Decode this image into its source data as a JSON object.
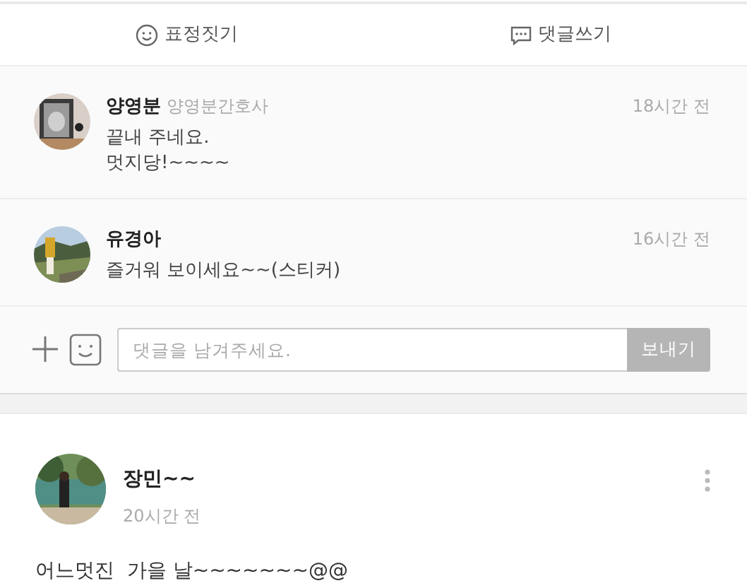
{
  "actions": [
    {
      "kind": "emoji",
      "label": "표정짓기"
    },
    {
      "kind": "comment",
      "label": "댓글쓰기"
    }
  ],
  "comments": [
    {
      "author": "양영분",
      "subtitle": "양영분간호사",
      "time": "18시간 전",
      "text": "끝내 주네요.\n멋지당!~~~~"
    },
    {
      "author": "유경아",
      "time": "16시간 전",
      "text": "즐거워 보이세요~~(스티커)"
    }
  ],
  "composer": {
    "placeholder": "댓글을 남겨주세요.",
    "send": "보내기"
  },
  "post": {
    "author": "장민~~",
    "time": "20시간 전",
    "text": "어느멋진  가을 날~~~~~~~@@"
  }
}
